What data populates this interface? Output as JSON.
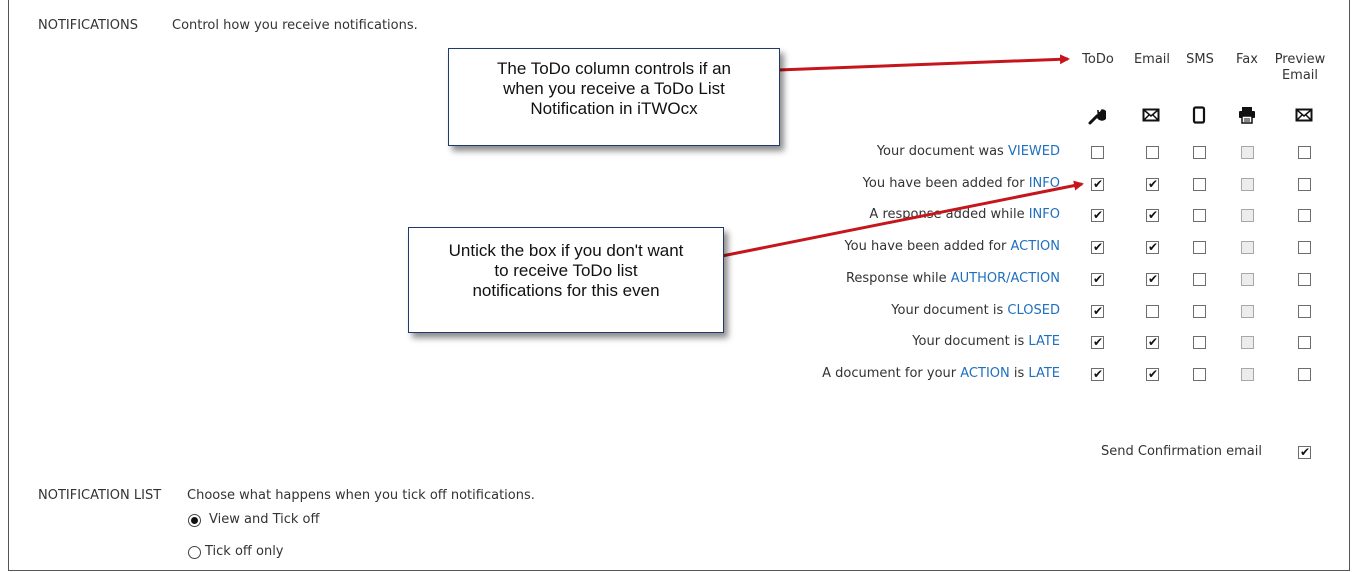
{
  "notifications": {
    "label": "NOTIFICATIONS",
    "description": "Control how you receive notifications.",
    "columns": [
      {
        "label": "ToDo",
        "icon": "wrench-icon"
      },
      {
        "label": "Email",
        "icon": "envelope-icon"
      },
      {
        "label": "SMS",
        "icon": "mobile-phone-icon"
      },
      {
        "label": "Fax",
        "icon": "printer-icon"
      },
      {
        "label_line1": "Preview",
        "label_line2": "Email",
        "icon": "envelope-icon"
      }
    ],
    "rows": [
      {
        "prefix": "Your document was ",
        "keyword": "VIEWED",
        "checks": [
          false,
          false,
          false,
          false,
          false
        ]
      },
      {
        "prefix": "You have been added for ",
        "keyword": "INFO",
        "checks": [
          true,
          true,
          false,
          false,
          false
        ]
      },
      {
        "prefix": "A response added while ",
        "keyword": "INFO",
        "checks": [
          true,
          true,
          false,
          false,
          false
        ]
      },
      {
        "prefix": "You have been added for ",
        "keyword": "ACTION",
        "checks": [
          true,
          true,
          false,
          false,
          false
        ]
      },
      {
        "prefix": "Response while ",
        "keyword": "AUTHOR/ACTION",
        "checks": [
          true,
          true,
          false,
          false,
          false
        ]
      },
      {
        "prefix": "Your document is ",
        "keyword": "CLOSED",
        "checks": [
          true,
          false,
          false,
          false,
          false
        ]
      },
      {
        "prefix": "Your document is ",
        "keyword": "LATE",
        "checks": [
          true,
          true,
          false,
          false,
          false
        ]
      },
      {
        "prefix": "A document for your ",
        "keyword": "ACTION",
        "mid": " is ",
        "keyword2": "LATE",
        "checks": [
          true,
          true,
          false,
          false,
          false
        ]
      }
    ],
    "send_confirmation": {
      "label": "Send Confirmation email",
      "checked": true
    }
  },
  "notification_list": {
    "label": "NOTIFICATION LIST",
    "description": "Choose what happens when you tick off notifications.",
    "options": [
      {
        "label": "View and Tick off",
        "selected": true
      },
      {
        "label": "Tick off only",
        "selected": false
      }
    ]
  },
  "callouts": {
    "todo_column": {
      "line1": "The ToDo column controls if an",
      "line2": "when you receive a ToDo List",
      "line3": "Notification in iTWOcx"
    },
    "untick": {
      "line1": "Untick the box if you don't want",
      "line2": "to receive ToDo list",
      "line3": "notifications for this even"
    }
  },
  "colors": {
    "keyword": "#1f6fbf",
    "arrow": "#c4161c",
    "callout_border": "#1f3a6b"
  }
}
